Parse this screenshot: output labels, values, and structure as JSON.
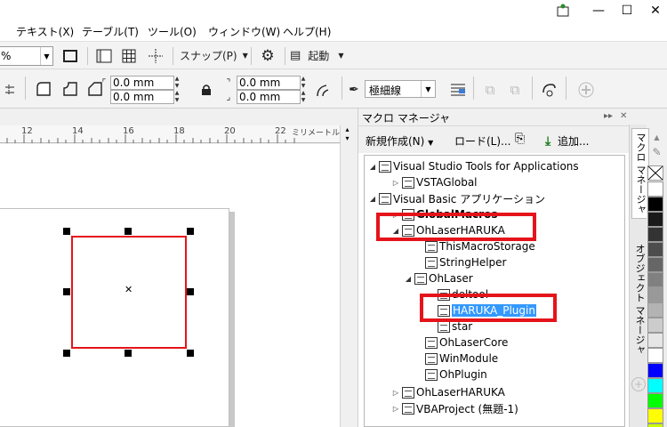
{
  "window": {
    "buttons": [
      "⬚",
      "—",
      "☐",
      "✕"
    ]
  },
  "menubar": {
    "items": [
      "テキスト(X)",
      "テーブル(T)",
      "ツール(O)",
      "ウィンドウ(W)",
      "ヘルプ(H)"
    ]
  },
  "toolbar1": {
    "zoom_value": "%",
    "snap_label": "スナップ(P)",
    "launch_label": "起動"
  },
  "toolbar2": {
    "width_value": "0.0 mm",
    "height_value": "0.0 mm",
    "right_width_value": "0.0 mm",
    "right_height_value": "0.0 mm",
    "outline_value": "極細線"
  },
  "ruler": {
    "labels": [
      "12",
      "14",
      "16",
      "18",
      "20",
      "22"
    ],
    "unit": "ミリメートル"
  },
  "docker": {
    "title": "マクロ マネージャ",
    "new_label": "新規作成(N)",
    "load_label": "ロード(L)...",
    "add_label": "追加...",
    "tree": [
      {
        "label": "Visual Studio Tools for Applications",
        "twisty": "◢"
      },
      {
        "label": "VSTAGlobal",
        "twisty": "▷"
      },
      {
        "label": "Visual Basic アプリケーション",
        "twisty": "◢"
      },
      {
        "label": "GlobalMacros",
        "twisty": "▷"
      },
      {
        "label": "OhLaserHARUKA",
        "twisty": "◢"
      },
      {
        "label": "ThisMacroStorage",
        "twisty": ""
      },
      {
        "label": "StringHelper",
        "twisty": ""
      },
      {
        "label": "OhLaser",
        "twisty": "◢"
      },
      {
        "label": "deltool",
        "twisty": ""
      },
      {
        "label": "HARUKA_Plugin",
        "twisty": ""
      },
      {
        "label": "star",
        "twisty": ""
      },
      {
        "label": "OhLaserCore",
        "twisty": ""
      },
      {
        "label": "WinModule",
        "twisty": ""
      },
      {
        "label": "OhPlugin",
        "twisty": ""
      },
      {
        "label": "OhLaserHARUKA",
        "twisty": "▷"
      },
      {
        "label": "VBAProject (無題-1)",
        "twisty": "▷"
      }
    ]
  },
  "side_tabs": {
    "macro_tab": "マクロ マネージャ",
    "object_tab": "オブジェクト マネージャ"
  },
  "palette_colors": [
    "#ffffff",
    "#000000",
    "#1a1a1a",
    "#333333",
    "#4d4d4d",
    "#666666",
    "#808080",
    "#999999",
    "#b3b3b3",
    "#cccccc",
    "#e6e6e6",
    "#ffffff",
    "#0000ff",
    "#00ffff",
    "#00ff00",
    "#ffff00",
    "#ccff00"
  ],
  "accent_red": "#e5141b",
  "selection_blue": "#3399ff"
}
